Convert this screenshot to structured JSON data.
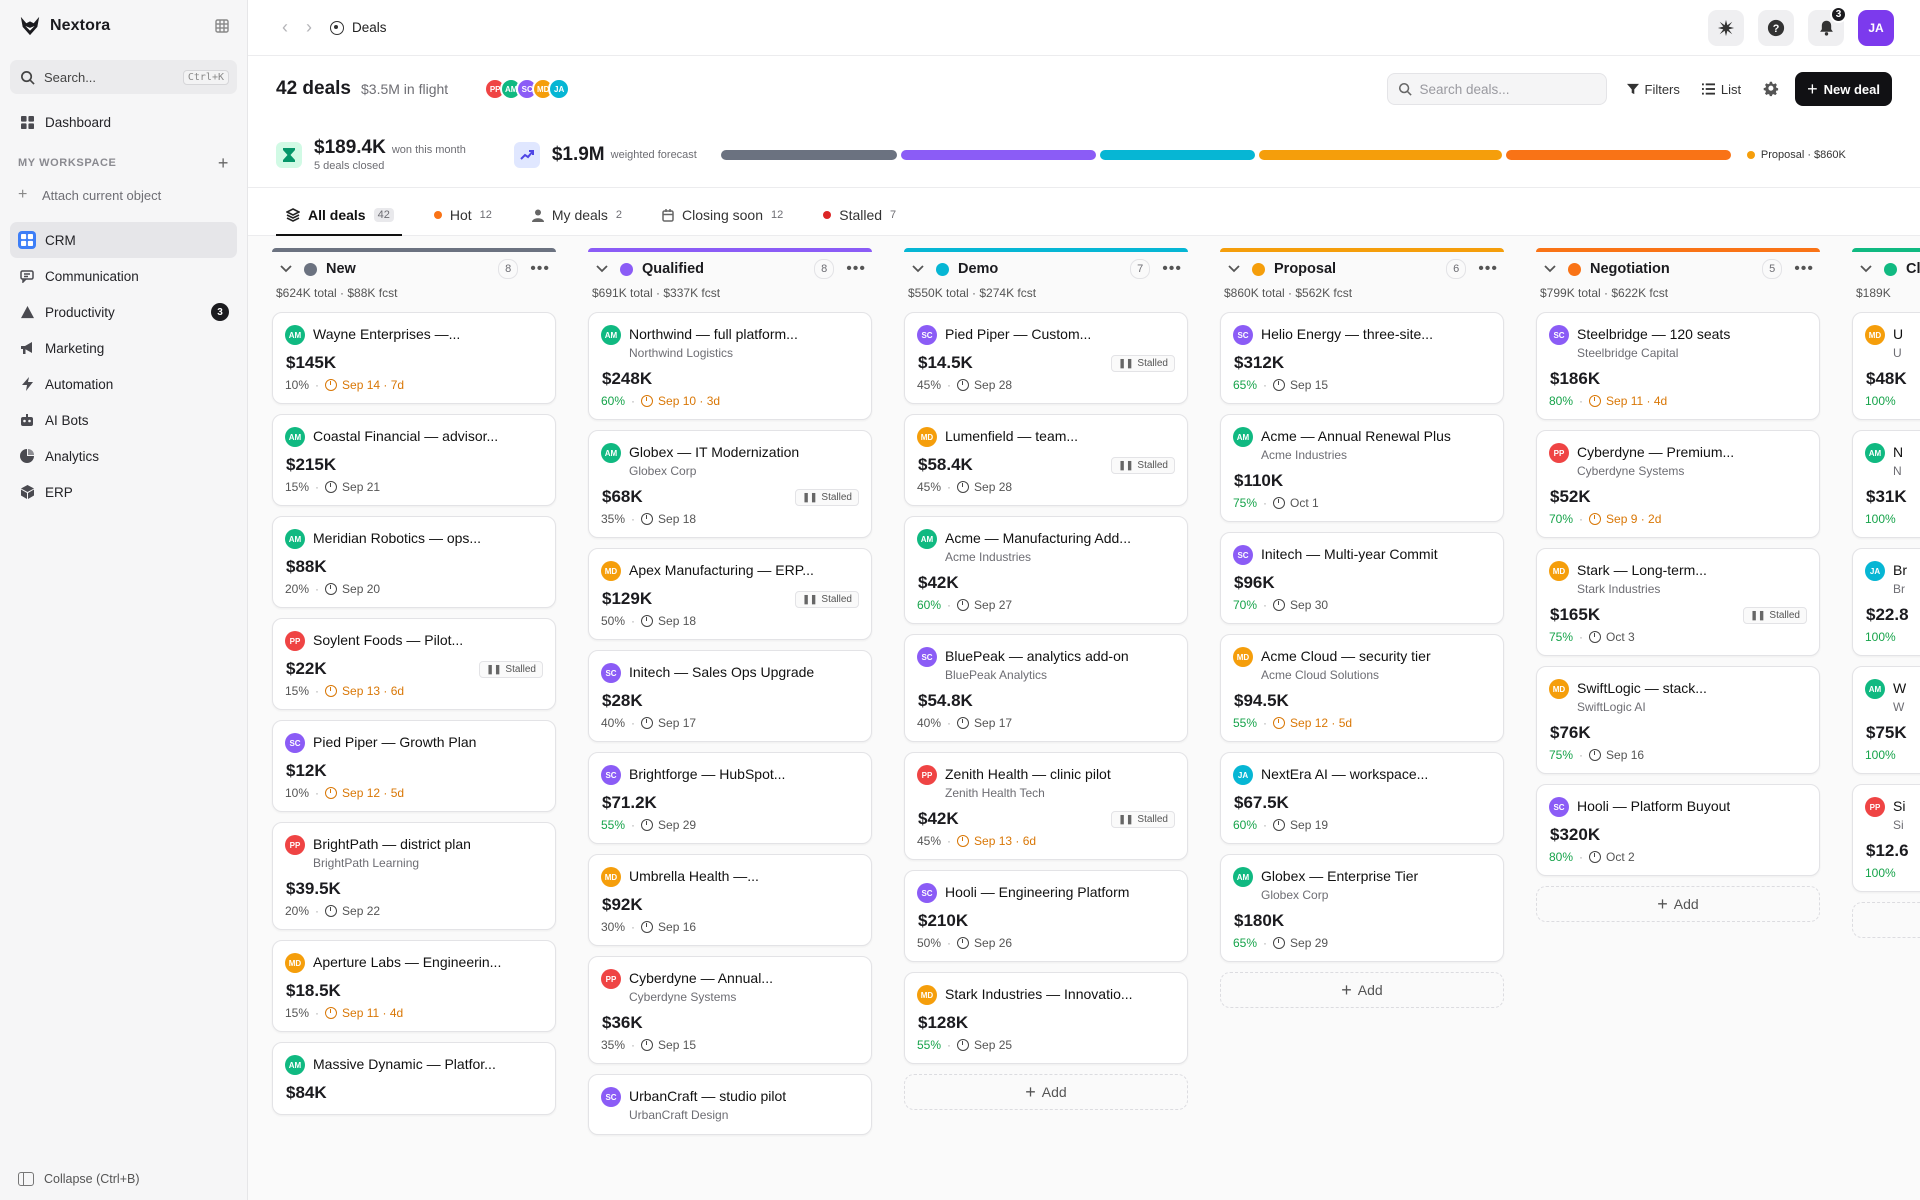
{
  "app": {
    "brand": "Nextora"
  },
  "sidebar": {
    "search_label": "Search...",
    "search_shortcut": "Ctrl+K",
    "dashboard": "Dashboard",
    "workspace_title": "MY WORKSPACE",
    "attach_label": "Attach current object",
    "items": [
      {
        "label": "CRM",
        "icon": "crm-icon",
        "active": true
      },
      {
        "label": "Communication",
        "icon": "chat-icon"
      },
      {
        "label": "Productivity",
        "icon": "productivity-icon",
        "badge": "3"
      },
      {
        "label": "Marketing",
        "icon": "megaphone-icon"
      },
      {
        "label": "Automation",
        "icon": "bolt-icon"
      },
      {
        "label": "AI Bots",
        "icon": "bot-icon"
      },
      {
        "label": "Analytics",
        "icon": "pie-icon"
      },
      {
        "label": "ERP",
        "icon": "cube-icon"
      }
    ],
    "collapse_label": "Collapse (Ctrl+B)"
  },
  "topbar": {
    "breadcrumb": "Deals",
    "notification_count": "3",
    "user_initials": "JA"
  },
  "header": {
    "deals_count": "42 deals",
    "in_flight": "$3.5M in flight",
    "avatars": [
      {
        "initials": "PP",
        "color": "#ef4444"
      },
      {
        "initials": "AM",
        "color": "#10b981"
      },
      {
        "initials": "SC",
        "color": "#8b5cf6"
      },
      {
        "initials": "MD",
        "color": "#f59e0b"
      },
      {
        "initials": "JA",
        "color": "#06b6d4"
      }
    ],
    "search_placeholder": "Search deals...",
    "filters_label": "Filters",
    "view_label": "List",
    "new_deal_label": "New deal"
  },
  "stats": {
    "won_amount": "$189.4K",
    "won_label": "won this month",
    "won_sub": "5 deals closed",
    "forecast_amount": "$1.9M",
    "forecast_label": "weighted forecast",
    "pipeline": [
      {
        "stage": "New",
        "value": 624,
        "color": "#6b7280"
      },
      {
        "stage": "Qualified",
        "value": 691,
        "color": "#8b5cf6"
      },
      {
        "stage": "Demo",
        "value": 550,
        "color": "#06b6d4"
      },
      {
        "stage": "Proposal",
        "value": 860,
        "color": "#f59e0b"
      },
      {
        "stage": "Negotiation",
        "value": 799,
        "color": "#f97316"
      }
    ],
    "legend": "Proposal · $860K",
    "legend_color": "#f59e0b"
  },
  "tabs": [
    {
      "label": "All deals",
      "count": "42",
      "active": true,
      "kind": "icon"
    },
    {
      "label": "Hot",
      "count": "12",
      "kind": "dot",
      "color": "#f97316"
    },
    {
      "label": "My deals",
      "count": "2",
      "kind": "person"
    },
    {
      "label": "Closing soon",
      "count": "12",
      "kind": "calendar"
    },
    {
      "label": "Stalled",
      "count": "7",
      "kind": "dot",
      "color": "#dc2626"
    }
  ],
  "columns": [
    {
      "name": "New",
      "count": "8",
      "color": "#6b7280",
      "totals": "$624K total · $88K fcst",
      "cards": [
        {
          "title": "Wayne Enterprises —...",
          "company": "",
          "owner": "AM",
          "amount": "$145K",
          "prob": "10%",
          "date": "Sep 14 · 7d",
          "urgent": true,
          "stalled": false
        },
        {
          "title": "Coastal Financial — advisor...",
          "company": "",
          "owner": "AM",
          "amount": "$215K",
          "prob": "15%",
          "date": "Sep 21",
          "urgent": false,
          "stalled": false
        },
        {
          "title": "Meridian Robotics — ops...",
          "company": "",
          "owner": "AM",
          "amount": "$88K",
          "prob": "20%",
          "date": "Sep 20",
          "urgent": false,
          "stalled": false
        },
        {
          "title": "Soylent Foods — Pilot...",
          "company": "",
          "owner": "PP",
          "amount": "$22K",
          "prob": "15%",
          "date": "Sep 13 · 6d",
          "urgent": true,
          "stalled": true
        },
        {
          "title": "Pied Piper — Growth Plan",
          "company": "",
          "owner": "SC",
          "amount": "$12K",
          "prob": "10%",
          "date": "Sep 12 · 5d",
          "urgent": true,
          "stalled": false
        },
        {
          "title": "BrightPath — district plan",
          "company": "BrightPath Learning",
          "owner": "PP",
          "amount": "$39.5K",
          "prob": "20%",
          "date": "Sep 22",
          "urgent": false,
          "stalled": false
        },
        {
          "title": "Aperture Labs — Engineerin...",
          "company": "",
          "owner": "MD",
          "amount": "$18.5K",
          "prob": "15%",
          "date": "Sep 11 · 4d",
          "urgent": true,
          "stalled": false
        },
        {
          "title": "Massive Dynamic — Platfor...",
          "company": "",
          "owner": "AM",
          "amount": "$84K",
          "prob": "",
          "date": "",
          "urgent": false,
          "stalled": false
        }
      ]
    },
    {
      "name": "Qualified",
      "count": "8",
      "color": "#8b5cf6",
      "totals": "$691K total · $337K fcst",
      "cards": [
        {
          "title": "Northwind — full platform...",
          "company": "Northwind Logistics",
          "owner": "AM",
          "amount": "$248K",
          "prob": "60%",
          "date": "Sep 10 · 3d",
          "urgent": true,
          "stalled": false
        },
        {
          "title": "Globex — IT Modernization",
          "company": "Globex Corp",
          "owner": "AM",
          "amount": "$68K",
          "prob": "35%",
          "date": "Sep 18",
          "urgent": false,
          "stalled": true
        },
        {
          "title": "Apex Manufacturing — ERP...",
          "company": "",
          "owner": "MD",
          "amount": "$129K",
          "prob": "50%",
          "date": "Sep 18",
          "urgent": false,
          "stalled": true
        },
        {
          "title": "Initech — Sales Ops Upgrade",
          "company": "",
          "owner": "SC",
          "amount": "$28K",
          "prob": "40%",
          "date": "Sep 17",
          "urgent": false,
          "stalled": false
        },
        {
          "title": "Brightforge — HubSpot...",
          "company": "",
          "owner": "SC",
          "amount": "$71.2K",
          "prob": "55%",
          "date": "Sep 29",
          "urgent": false,
          "stalled": false
        },
        {
          "title": "Umbrella Health —...",
          "company": "",
          "owner": "MD",
          "amount": "$92K",
          "prob": "30%",
          "date": "Sep 16",
          "urgent": false,
          "stalled": false
        },
        {
          "title": "Cyberdyne — Annual...",
          "company": "Cyberdyne Systems",
          "owner": "PP",
          "amount": "$36K",
          "prob": "35%",
          "date": "Sep 15",
          "urgent": false,
          "stalled": false
        },
        {
          "title": "UrbanCraft — studio pilot",
          "company": "UrbanCraft Design",
          "owner": "SC",
          "amount": "",
          "prob": "",
          "date": "",
          "urgent": false,
          "stalled": false
        }
      ]
    },
    {
      "name": "Demo",
      "count": "7",
      "color": "#06b6d4",
      "totals": "$550K total · $274K fcst",
      "cards": [
        {
          "title": "Pied Piper — Custom...",
          "company": "",
          "owner": "SC",
          "amount": "$14.5K",
          "prob": "45%",
          "date": "Sep 28",
          "urgent": false,
          "stalled": true
        },
        {
          "title": "Lumenfield — team...",
          "company": "",
          "owner": "MD",
          "amount": "$58.4K",
          "prob": "45%",
          "date": "Sep 28",
          "urgent": false,
          "stalled": true
        },
        {
          "title": "Acme — Manufacturing Add...",
          "company": "Acme Industries",
          "owner": "AM",
          "amount": "$42K",
          "prob": "60%",
          "date": "Sep 27",
          "urgent": false,
          "stalled": false
        },
        {
          "title": "BluePeak — analytics add-on",
          "company": "BluePeak Analytics",
          "owner": "SC",
          "amount": "$54.8K",
          "prob": "40%",
          "date": "Sep 17",
          "urgent": false,
          "stalled": false
        },
        {
          "title": "Zenith Health — clinic pilot",
          "company": "Zenith Health Tech",
          "owner": "PP",
          "amount": "$42K",
          "prob": "45%",
          "date": "Sep 13 · 6d",
          "urgent": true,
          "stalled": true
        },
        {
          "title": "Hooli — Engineering Platform",
          "company": "",
          "owner": "SC",
          "amount": "$210K",
          "prob": "50%",
          "date": "Sep 26",
          "urgent": false,
          "stalled": false
        },
        {
          "title": "Stark Industries — Innovatio...",
          "company": "",
          "owner": "MD",
          "amount": "$128K",
          "prob": "55%",
          "date": "Sep 25",
          "urgent": false,
          "stalled": false
        }
      ]
    },
    {
      "name": "Proposal",
      "count": "6",
      "color": "#f59e0b",
      "totals": "$860K total · $562K fcst",
      "cards": [
        {
          "title": "Helio Energy — three-site...",
          "company": "",
          "owner": "SC",
          "amount": "$312K",
          "prob": "65%",
          "date": "Sep 15",
          "urgent": false,
          "stalled": false
        },
        {
          "title": "Acme — Annual Renewal Plus",
          "company": "Acme Industries",
          "owner": "AM",
          "amount": "$110K",
          "prob": "75%",
          "date": "Oct 1",
          "urgent": false,
          "stalled": false
        },
        {
          "title": "Initech — Multi-year Commit",
          "company": "",
          "owner": "SC",
          "amount": "$96K",
          "prob": "70%",
          "date": "Sep 30",
          "urgent": false,
          "stalled": false
        },
        {
          "title": "Acme Cloud — security tier",
          "company": "Acme Cloud Solutions",
          "owner": "MD",
          "amount": "$94.5K",
          "prob": "55%",
          "date": "Sep 12 · 5d",
          "urgent": true,
          "stalled": false
        },
        {
          "title": "NextEra AI — workspace...",
          "company": "",
          "owner": "JA",
          "amount": "$67.5K",
          "prob": "60%",
          "date": "Sep 19",
          "urgent": false,
          "stalled": false
        },
        {
          "title": "Globex — Enterprise Tier",
          "company": "Globex Corp",
          "owner": "AM",
          "amount": "$180K",
          "prob": "65%",
          "date": "Sep 29",
          "urgent": false,
          "stalled": false
        }
      ]
    },
    {
      "name": "Negotiation",
      "count": "5",
      "color": "#f97316",
      "totals": "$799K total · $622K fcst",
      "cards": [
        {
          "title": "Steelbridge — 120 seats",
          "company": "Steelbridge Capital",
          "owner": "SC",
          "amount": "$186K",
          "prob": "80%",
          "date": "Sep 11 · 4d",
          "urgent": true,
          "stalled": false
        },
        {
          "title": "Cyberdyne — Premium...",
          "company": "Cyberdyne Systems",
          "owner": "PP",
          "amount": "$52K",
          "prob": "70%",
          "date": "Sep 9 · 2d",
          "urgent": true,
          "stalled": false
        },
        {
          "title": "Stark — Long-term...",
          "company": "Stark Industries",
          "owner": "MD",
          "amount": "$165K",
          "prob": "75%",
          "date": "Oct 3",
          "urgent": false,
          "stalled": true
        },
        {
          "title": "SwiftLogic — stack...",
          "company": "SwiftLogic AI",
          "owner": "MD",
          "amount": "$76K",
          "prob": "75%",
          "date": "Sep 16",
          "urgent": false,
          "stalled": false
        },
        {
          "title": "Hooli — Platform Buyout",
          "company": "",
          "owner": "SC",
          "amount": "$320K",
          "prob": "80%",
          "date": "Oct 2",
          "urgent": false,
          "stalled": false
        }
      ]
    },
    {
      "name": "Closed",
      "count": "",
      "color": "#10b981",
      "totals": "$189K",
      "cards": [
        {
          "title": "U",
          "company": "U",
          "owner": "MD",
          "amount": "$48K",
          "prob": "100%",
          "date": "",
          "urgent": false,
          "stalled": false
        },
        {
          "title": "N",
          "company": "N",
          "owner": "AM",
          "amount": "$31K",
          "prob": "100%",
          "date": "",
          "urgent": false,
          "stalled": false
        },
        {
          "title": "Br",
          "company": "Br",
          "owner": "JA",
          "amount": "$22.8",
          "prob": "100%",
          "date": "",
          "urgent": false,
          "stalled": false
        },
        {
          "title": "W",
          "company": "W",
          "owner": "AM",
          "amount": "$75K",
          "prob": "100%",
          "date": "",
          "urgent": false,
          "stalled": false
        },
        {
          "title": "Si",
          "company": "Si",
          "owner": "PP",
          "amount": "$12.6",
          "prob": "100%",
          "date": "",
          "urgent": false,
          "stalled": false
        }
      ]
    }
  ],
  "labels": {
    "add": "Add",
    "stalled": "Stalled"
  },
  "owner_colors": {
    "AM": "#10b981",
    "SC": "#8b5cf6",
    "PP": "#ef4444",
    "MD": "#f59e0b",
    "JA": "#06b6d4"
  }
}
